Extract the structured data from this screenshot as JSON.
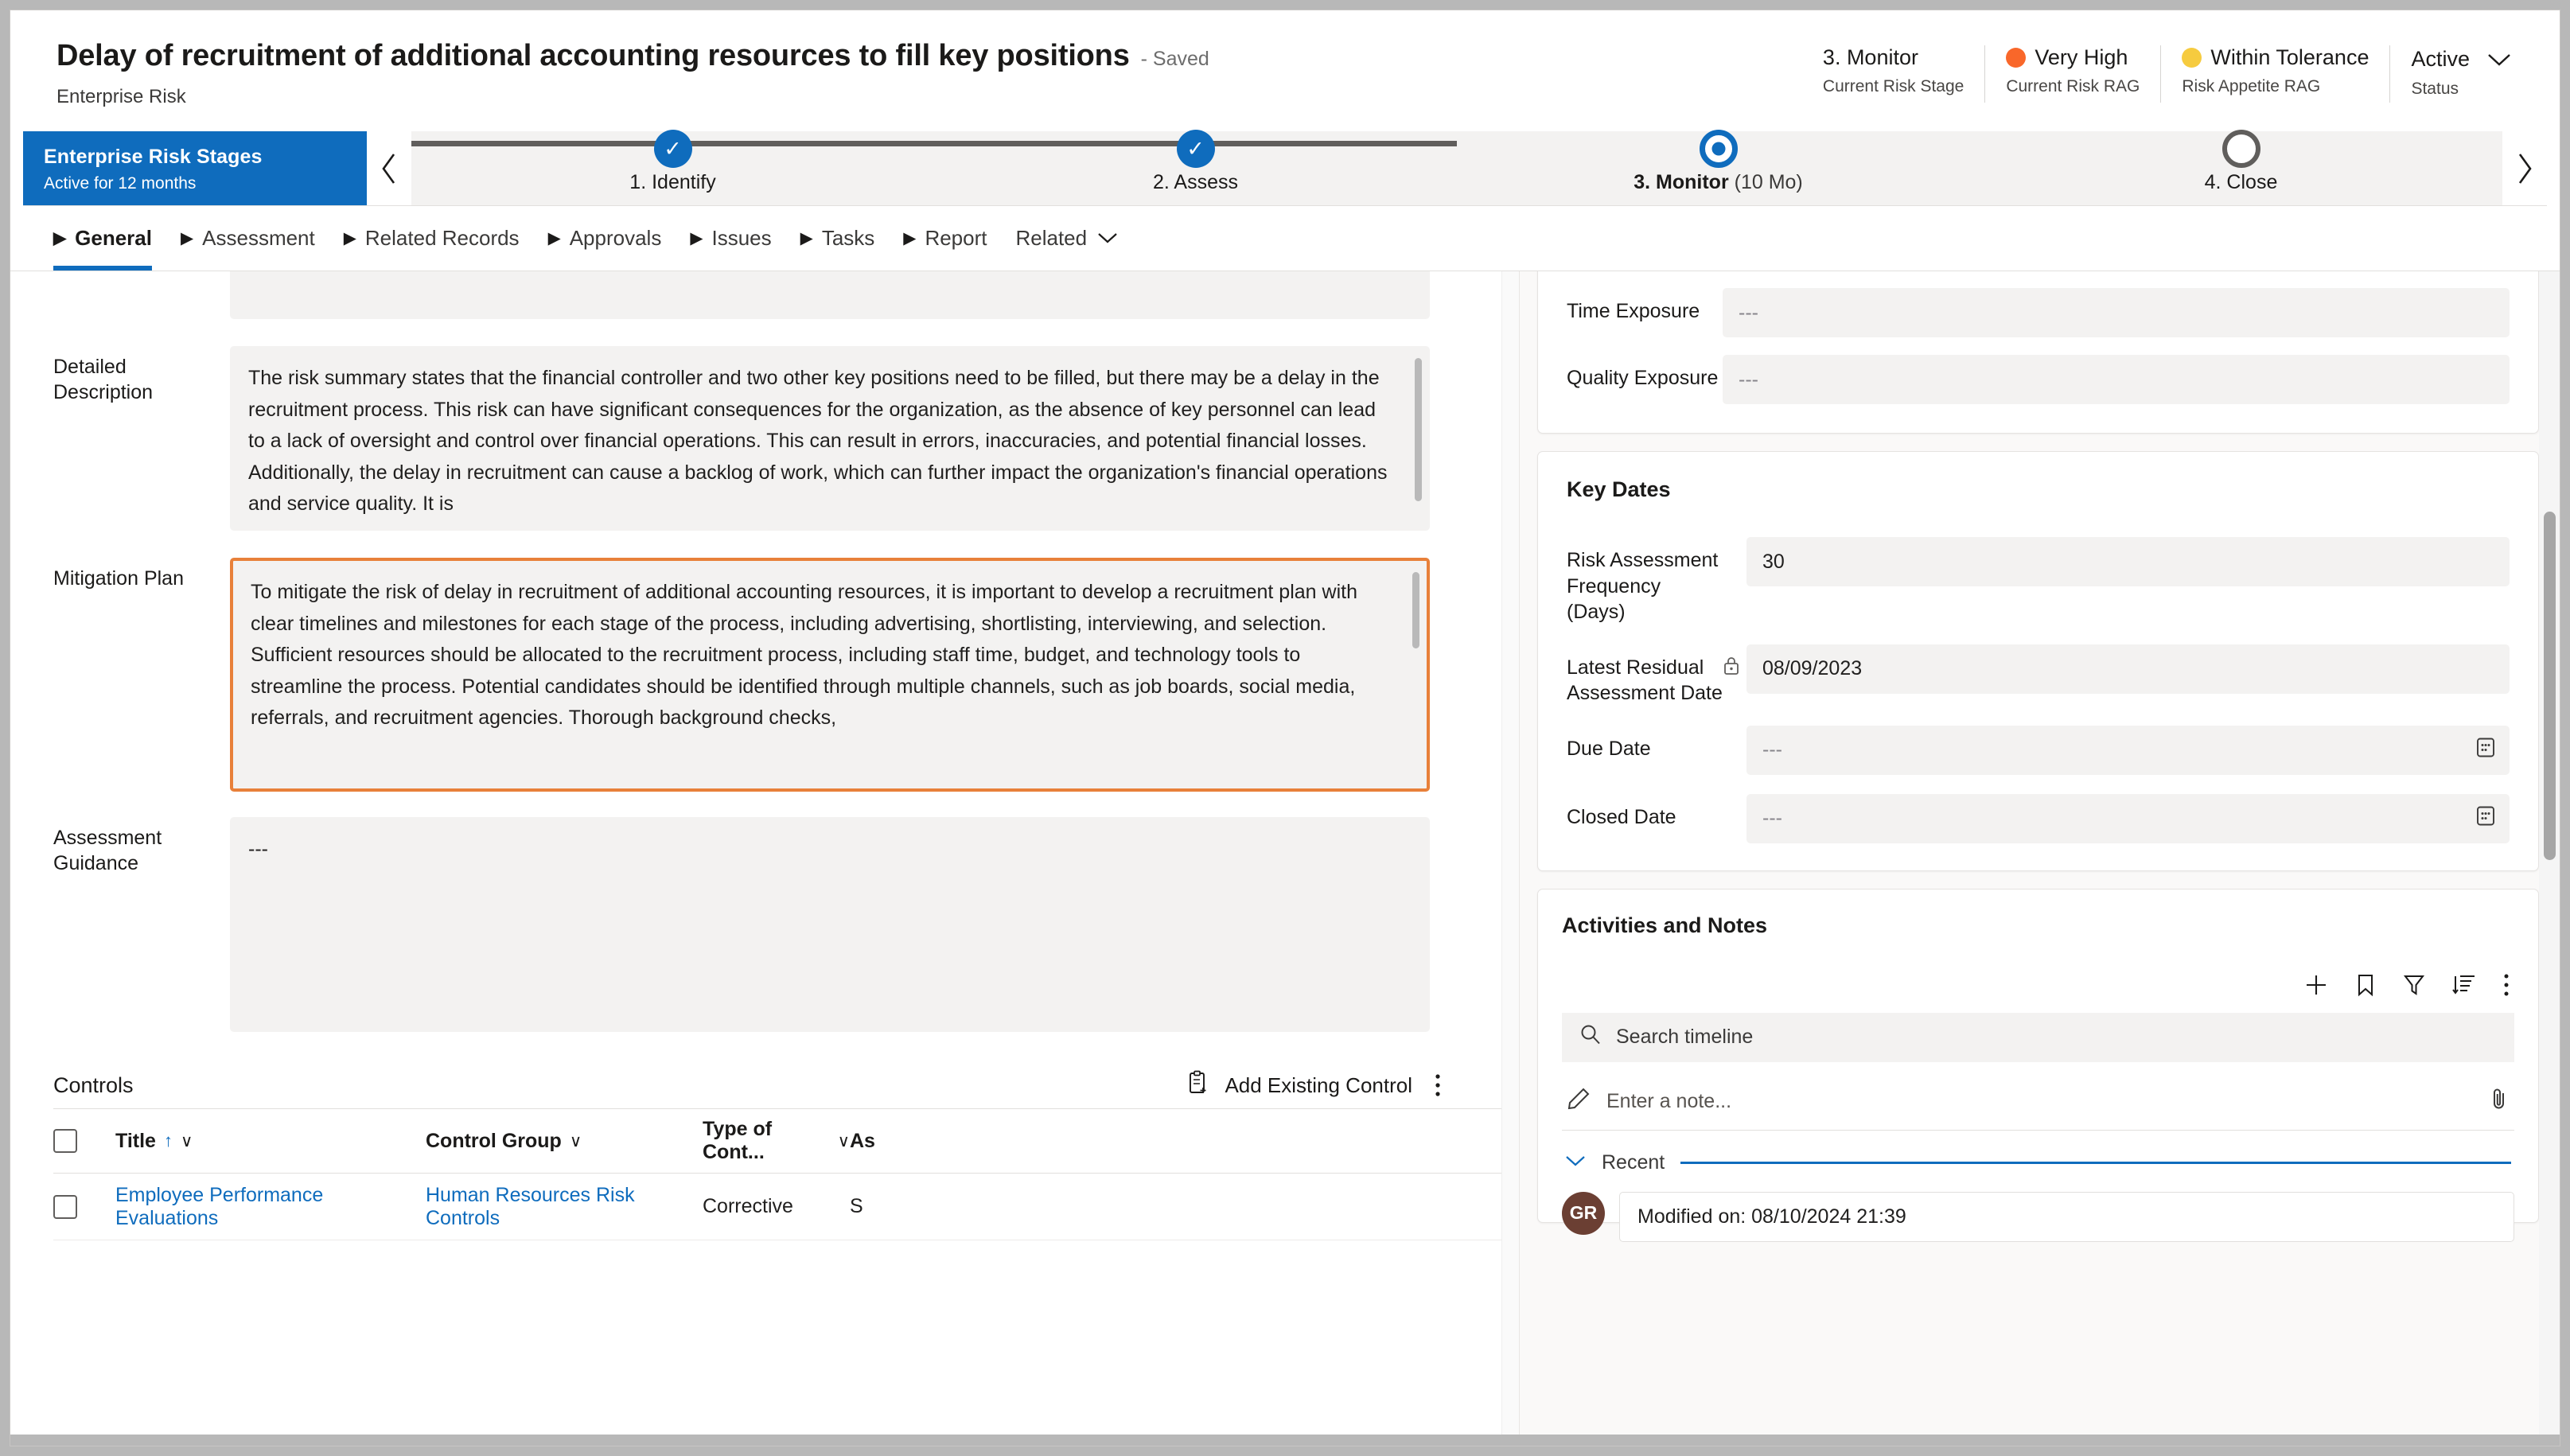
{
  "header": {
    "record_title": "Delay of recruitment of additional accounting resources to fill key positions",
    "saved_label": "- Saved",
    "entity_name": "Enterprise Risk",
    "stats": [
      {
        "value": "3. Monitor",
        "label": "Current Risk Stage",
        "dot": ""
      },
      {
        "value": "Very High",
        "label": "Current Risk RAG",
        "dot": "#f9672a"
      },
      {
        "value": "Within Tolerance",
        "label": "Risk Appetite RAG",
        "dot": "#f6cb3f"
      },
      {
        "value": "Active",
        "label": "Status",
        "dot": ""
      }
    ],
    "caret_icon": "chevron-down"
  },
  "bpf": {
    "stage_title": "Enterprise Risk Stages",
    "stage_sub": "Active for 12 months",
    "prev_icon": "‹",
    "next_icon": "›",
    "steps": [
      {
        "label": "1. Identify",
        "state": "done",
        "glyph": "✓"
      },
      {
        "label": "2. Assess",
        "state": "done",
        "glyph": "✓"
      },
      {
        "label": "3. Monitor",
        "suffix": "(10 Mo)",
        "state": "current",
        "glyph": ""
      },
      {
        "label": "4. Close",
        "state": "future",
        "glyph": ""
      }
    ]
  },
  "tabs": [
    {
      "label": "General",
      "active": true
    },
    {
      "label": "Assessment",
      "active": false
    },
    {
      "label": "Related Records",
      "active": false
    },
    {
      "label": "Approvals",
      "active": false
    },
    {
      "label": "Issues",
      "active": false
    },
    {
      "label": "Tasks",
      "active": false
    },
    {
      "label": "Report",
      "active": false
    }
  ],
  "related_tab": {
    "label": "Related",
    "chevron": "∨"
  },
  "left": {
    "detailed_description": {
      "label": "Detailed Description",
      "value": "The risk summary states that the financial controller and two other key positions need to be filled, but there may be a delay in the recruitment process. This risk can have significant consequences for the organization, as the absence of key personnel can lead to a lack of oversight and control over financial operations. This can result in errors, inaccuracies, and potential financial losses. Additionally, the delay in recruitment can cause a backlog of work, which can further impact the organization's financial operations and service quality. It is"
    },
    "mitigation_plan": {
      "label": "Mitigation Plan",
      "value": "To mitigate the risk of delay in recruitment of additional accounting resources, it is important to develop a recruitment plan with clear timelines and milestones for each stage of the process, including advertising, shortlisting, interviewing, and selection. Sufficient resources should be allocated to the recruitment process, including staff time, budget, and technology tools to streamline the process. Potential candidates should be identified through multiple channels, such as job boards, social media, referrals, and recruitment agencies. Thorough background checks,",
      "focused": true,
      "focus_color": "#e8803a"
    },
    "assessment_guidance": {
      "label": "Assessment Guidance",
      "value": "---"
    },
    "controls": {
      "title": "Controls",
      "add_existing_label": "Add Existing Control",
      "add_existing_icon": "clipboard-add-icon",
      "overflow_icon": "more-vertical-icon",
      "columns": [
        {
          "label": "Title",
          "sort": "↑",
          "chevron": "∨"
        },
        {
          "label": "Control Group",
          "sort": "",
          "chevron": "∨"
        },
        {
          "label": "Type of Cont...",
          "sort": "",
          "chevron": "∨"
        },
        {
          "label": "As",
          "sort": "",
          "chevron": ""
        }
      ],
      "rows": [
        {
          "title": "Employee Performance Evaluations",
          "control_group": "Human Resources Risk Controls",
          "type": "Corrective",
          "as": "S"
        }
      ]
    }
  },
  "right": {
    "exposure_card": {
      "fields": [
        {
          "label": "Time Exposure",
          "value": "---"
        },
        {
          "label": "Quality Exposure",
          "value": "---"
        }
      ]
    },
    "key_dates": {
      "title": "Key Dates",
      "fields": [
        {
          "label": "Risk Assessment Frequency (Days)",
          "value": "30",
          "locked": false,
          "calendar": false
        },
        {
          "label": "Latest Residual Assessment Date",
          "value": "08/09/2023",
          "locked": true,
          "calendar": false
        },
        {
          "label": "Due Date",
          "value": "---",
          "locked": false,
          "calendar": true
        },
        {
          "label": "Closed Date",
          "value": "---",
          "locked": false,
          "calendar": true
        }
      ]
    },
    "timeline": {
      "title": "Activities and Notes",
      "toolbar": [
        {
          "name": "add-icon",
          "glyph": "+"
        },
        {
          "name": "bookmark-icon",
          "glyph": ""
        },
        {
          "name": "filter-icon",
          "glyph": ""
        },
        {
          "name": "sort-icon",
          "glyph": ""
        },
        {
          "name": "more-vertical-icon",
          "glyph": "⋮"
        }
      ],
      "search_placeholder": "Search timeline",
      "note_placeholder": "Enter a note...",
      "attach_icon": "paperclip-icon",
      "recent_label": "Recent",
      "recent_chevron": "∨",
      "items": [
        {
          "initials": "GR",
          "text": "Modified on: 08/10/2024 21:39",
          "avatar_color": "#6b3f33"
        }
      ]
    }
  }
}
